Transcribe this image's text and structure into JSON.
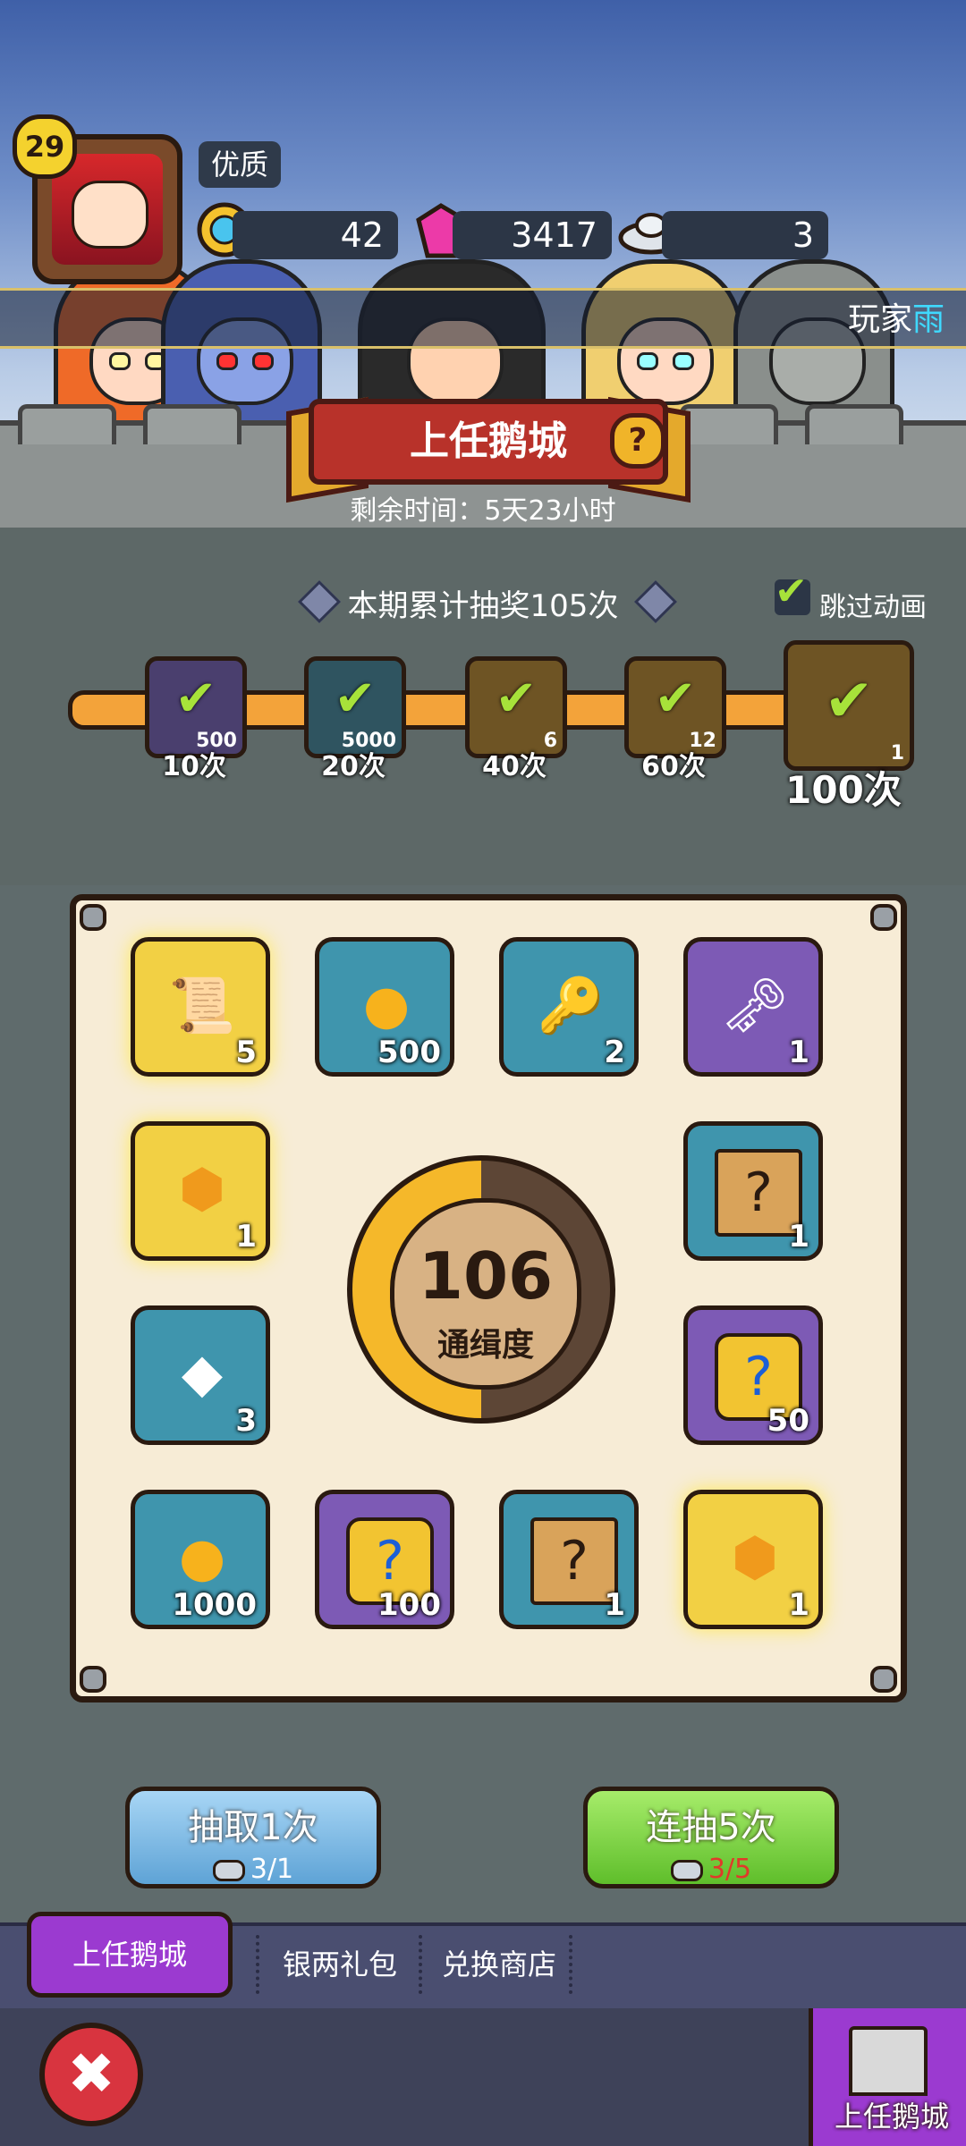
{
  "player": {
    "level": "29",
    "quality": "优质",
    "name_prefix": "玩家",
    "name_suffix": "雨"
  },
  "resources": [
    {
      "icon": "blue-gem-coin-icon",
      "value": "42"
    },
    {
      "icon": "pink-crystal-icon",
      "value": "3417"
    },
    {
      "icon": "silver-ingot-icon",
      "value": "3"
    }
  ],
  "event": {
    "title": "上任鹅城",
    "help": "?",
    "time_left": "剩余时间：5天23小时",
    "draw_count_text": "本期累计抽奖105次",
    "skip_animation": "跳过动画"
  },
  "milestones": [
    {
      "label": "10次",
      "qty": "500",
      "claimed": true,
      "color": "#4a3f6e"
    },
    {
      "label": "20次",
      "qty": "5000",
      "claimed": true,
      "color": "#2f5460"
    },
    {
      "label": "40次",
      "qty": "6",
      "claimed": true,
      "color": "#6e5424"
    },
    {
      "label": "60次",
      "qty": "12",
      "claimed": true,
      "color": "#6e5424"
    },
    {
      "label": "100次",
      "qty": "1",
      "claimed": true,
      "color": "#6e5424"
    }
  ],
  "check_glyph": "✔",
  "rewards": [
    {
      "name": "scroll-reward",
      "icon": "scroll-icon",
      "glyph": "📜",
      "qty": "5",
      "style": "gold"
    },
    {
      "name": "coin-reward-500",
      "icon": "gold-coin-icon",
      "glyph": "●",
      "qty": "500",
      "style": "blue"
    },
    {
      "name": "silver-key-reward",
      "icon": "silver-key-icon",
      "glyph": "🔑",
      "qty": "2",
      "style": "blue"
    },
    {
      "name": "gold-key-reward",
      "icon": "gold-key-icon",
      "glyph": "🗝",
      "qty": "1",
      "style": "purple"
    },
    {
      "name": "amber-gem-reward",
      "icon": "amber-gem-icon",
      "glyph": "⬢",
      "qty": "1",
      "style": "gold"
    },
    {
      "name": "mystery-banner-reward",
      "icon": "mystery-banner-icon",
      "glyph": "?",
      "qty": "1",
      "style": "blue"
    },
    {
      "name": "rune-stone-reward",
      "icon": "rune-stone-icon",
      "glyph": "◆",
      "qty": "3",
      "style": "blue"
    },
    {
      "name": "puzzle-reward-50",
      "icon": "puzzle-piece-icon",
      "glyph": "?",
      "qty": "50",
      "style": "purple"
    },
    {
      "name": "coin-reward-1000",
      "icon": "gold-coin-icon",
      "glyph": "●",
      "qty": "1000",
      "style": "blue"
    },
    {
      "name": "puzzle-reward-100",
      "icon": "puzzle-piece-icon",
      "glyph": "?",
      "qty": "100",
      "style": "purple"
    },
    {
      "name": "mystery-banner-reward-2",
      "icon": "mystery-banner-icon",
      "glyph": "?",
      "qty": "1",
      "style": "blue"
    },
    {
      "name": "gold-gem-reward",
      "icon": "yellow-gem-icon",
      "glyph": "⬢",
      "qty": "1",
      "style": "gold"
    }
  ],
  "wanted": {
    "value": "106",
    "label": "通缉度",
    "progress": 0.5
  },
  "buttons": {
    "single_label": "抽取1次",
    "single_cost": "3/1",
    "five_label": "连抽5次",
    "five_cost": "3/5"
  },
  "tabs": {
    "active": "上任鹅城",
    "silver_pack": "银两礼包",
    "exchange_shop": "兑换商店"
  },
  "bottom": {
    "close_glyph": "✖",
    "castle_label": "上任鹅城"
  }
}
